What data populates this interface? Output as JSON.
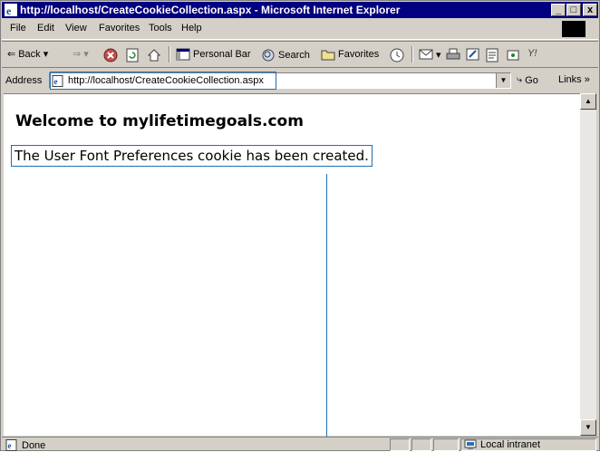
{
  "window": {
    "title": "http://localhost/CreateCookieCollection.aspx - Microsoft Internet Explorer",
    "controls": [
      "_",
      "□",
      "x"
    ]
  },
  "menu": {
    "items": [
      "File",
      "Edit",
      "View",
      "Favorites",
      "Tools",
      "Help"
    ]
  },
  "toolbar": {
    "back_label": "Back",
    "personal_bar_label": "Personal Bar",
    "search_label": "Search",
    "favorites_label": "Favorites"
  },
  "address": {
    "label": "Address",
    "url": "http://localhost/CreateCookieCollection.aspx",
    "go_label": "Go",
    "links_label": "Links »"
  },
  "page": {
    "heading": "Welcome to mylifetimegoals.com",
    "message": "The User Font Preferences cookie has been created."
  },
  "status": {
    "text": "Done",
    "zone": "Local intranet"
  },
  "colors": {
    "titlebar": "#000080",
    "chrome": "#d4d0c8",
    "highlight": "#1e6fb4"
  }
}
